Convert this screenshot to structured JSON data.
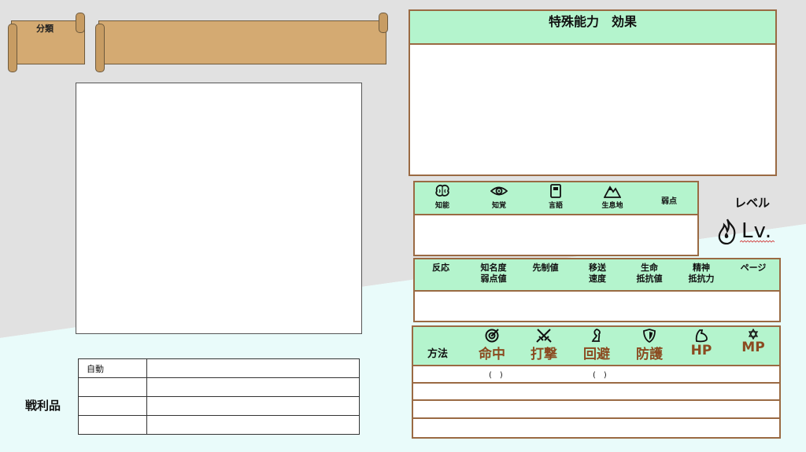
{
  "header": {
    "category_label": "分類",
    "name_value": ""
  },
  "loot": {
    "title": "戦利品",
    "rows": [
      {
        "roll": "自動",
        "item": ""
      },
      {
        "roll": "",
        "item": ""
      },
      {
        "roll": "",
        "item": ""
      },
      {
        "roll": "",
        "item": ""
      }
    ]
  },
  "special": {
    "title": "特殊能力　効果",
    "body": ""
  },
  "knowledge": {
    "items": [
      {
        "label": "知能",
        "icon": "brain-icon"
      },
      {
        "label": "知覚",
        "icon": "eye-icon"
      },
      {
        "label": "言語",
        "icon": "book-icon"
      },
      {
        "label": "生息地",
        "icon": "mountain-icon"
      }
    ],
    "weakness_label": "弱点"
  },
  "level": {
    "label": "レベル",
    "lv_text": "Lv."
  },
  "stats": {
    "columns": [
      "反応",
      "知名度\n弱点値",
      "先制値",
      "移送\n速度",
      "生命\n抵抗値",
      "精神\n抵抗力",
      "ページ"
    ]
  },
  "combat": {
    "method_label": "方法",
    "columns": [
      {
        "label": "命中",
        "icon": "target-icon"
      },
      {
        "label": "打撃",
        "icon": "crossed-swords-icon"
      },
      {
        "label": "回避",
        "icon": "leg-icon"
      },
      {
        "label": "防護",
        "icon": "shield-icon"
      },
      {
        "label": "HP",
        "icon": "arm-icon"
      },
      {
        "label": "MP",
        "icon": "star-icon"
      }
    ],
    "paren_1": "(　)",
    "paren_2": "(　)"
  },
  "colors": {
    "header_green": "#b4f4cd",
    "border_brown": "#9a6a43",
    "scroll_tan": "#d4aa72",
    "label_brown": "#8b4a20"
  }
}
